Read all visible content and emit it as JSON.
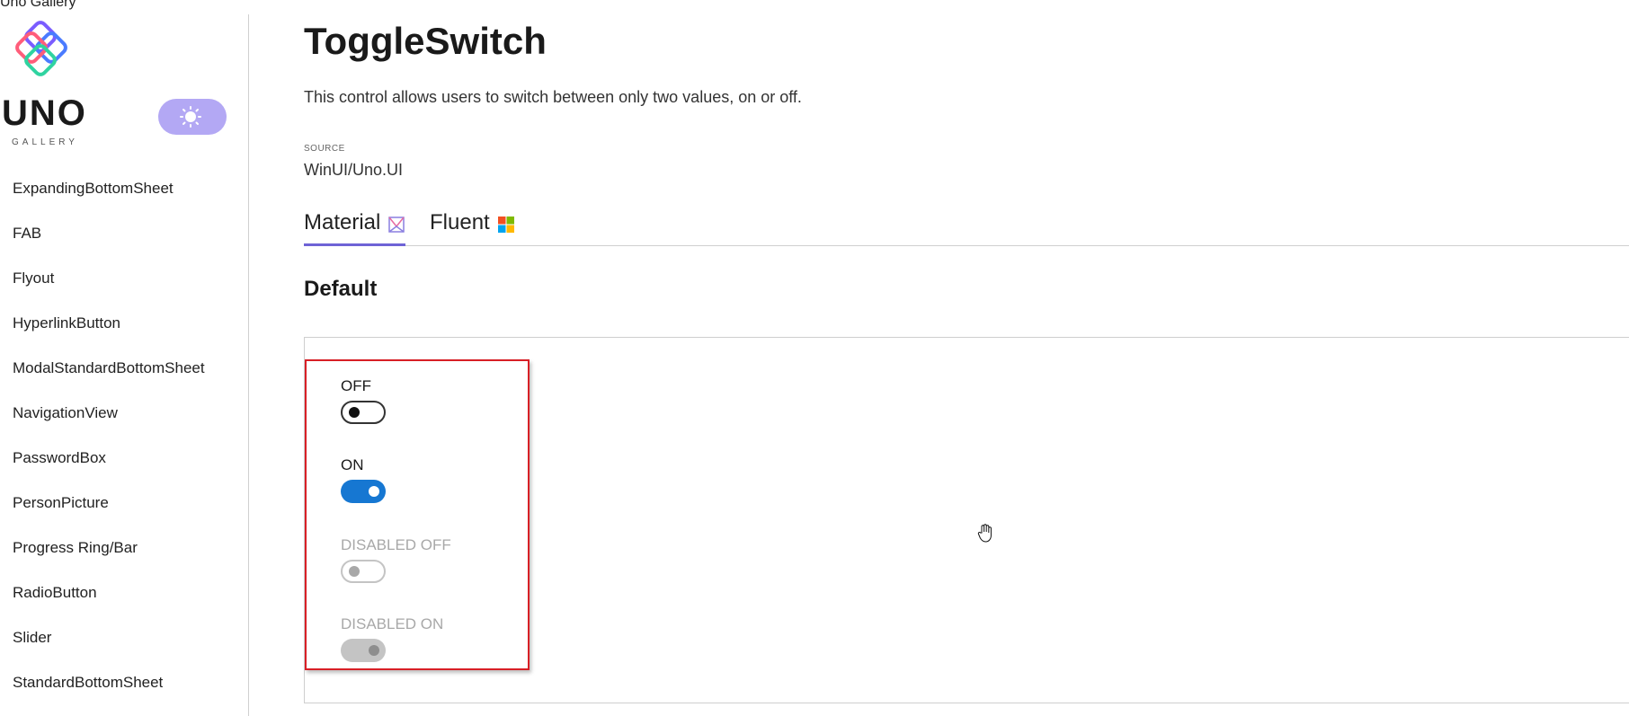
{
  "window": {
    "title": "Uno Gallery"
  },
  "sidebar": {
    "logo": {
      "wordmark": "UNO",
      "subtitle": "GALLERY",
      "icon": "uno-logo"
    },
    "theme_toggle": {
      "icon": "sun-icon",
      "color": "#b3a8f4"
    },
    "items": [
      {
        "label": "ExpandingBottomSheet"
      },
      {
        "label": "FAB"
      },
      {
        "label": "Flyout"
      },
      {
        "label": "HyperlinkButton"
      },
      {
        "label": "ModalStandardBottomSheet"
      },
      {
        "label": "NavigationView"
      },
      {
        "label": "PasswordBox"
      },
      {
        "label": "PersonPicture"
      },
      {
        "label": "Progress Ring/Bar"
      },
      {
        "label": "RadioButton"
      },
      {
        "label": "Slider"
      },
      {
        "label": "StandardBottomSheet"
      }
    ]
  },
  "page": {
    "title": "ToggleSwitch",
    "description": "This control allows users to switch between only two values, on or off.",
    "source_label": "SOURCE",
    "source_value": "WinUI/Uno.UI"
  },
  "tabs": [
    {
      "label": "Material",
      "icon": "material-icon",
      "active": true
    },
    {
      "label": "Fluent",
      "icon": "windows-icon",
      "active": false
    }
  ],
  "section": {
    "title": "Default"
  },
  "switches": [
    {
      "label": "OFF",
      "state": "off",
      "disabled": false
    },
    {
      "label": "ON",
      "state": "on",
      "disabled": false
    },
    {
      "label": "DISABLED OFF",
      "state": "off",
      "disabled": true
    },
    {
      "label": "DISABLED ON",
      "state": "on",
      "disabled": true
    }
  ],
  "colors": {
    "accent": "#6e63d6",
    "switch_on": "#1677d2",
    "highlight_border": "#d81f26"
  }
}
